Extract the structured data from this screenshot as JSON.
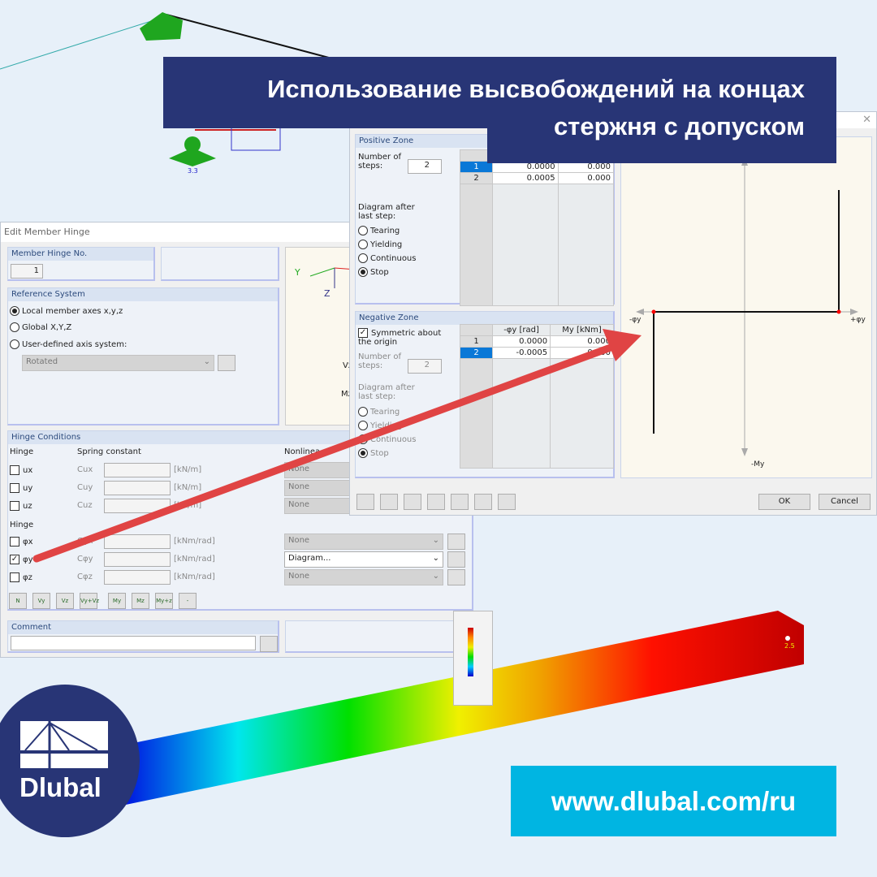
{
  "banner": {
    "line1": "Использование высвобождений на концах",
    "line2": "стержня с допуском",
    "color": "#283576"
  },
  "model": {
    "node_label": "3.3",
    "beam_value": "2.5"
  },
  "left_dialog": {
    "title": "Edit Member Hinge",
    "hinge_no": {
      "label": "Member Hinge No.",
      "value": "1"
    },
    "reference": {
      "label": "Reference System",
      "options": [
        "Local member axes x,y,z",
        "Global X,Y,Z",
        "User-defined axis system:"
      ],
      "selected": 0,
      "axis_value": "Rotated"
    },
    "preview_axes": {
      "y": "Y",
      "z": "Z",
      "vz": "Vz",
      "mz": "Mz"
    },
    "conditions": {
      "label": "Hinge Conditions",
      "hinge_label": "Hinge",
      "spring_label": "Spring constant",
      "nonlinear_label": "Nonlinea",
      "translations": [
        {
          "name": "ux",
          "const": "Cux",
          "unit": "[kN/m]",
          "checked": false,
          "nonlinear": "None"
        },
        {
          "name": "uy",
          "const": "Cuy",
          "unit": "[kN/m]",
          "checked": false,
          "nonlinear": "None"
        },
        {
          "name": "uz",
          "const": "Cuz",
          "unit": "[kN/m]",
          "checked": false,
          "nonlinear": "None"
        }
      ],
      "hinge_label2": "Hinge",
      "rotations": [
        {
          "name": "φx",
          "const": "Cφx",
          "unit": "[kNm/rad]",
          "checked": false,
          "nonlinear": "None"
        },
        {
          "name": "φy",
          "const": "Cφy",
          "unit": "[kNm/rad]",
          "checked": true,
          "nonlinear": "Diagram..."
        },
        {
          "name": "φz",
          "const": "Cφz",
          "unit": "[kNm/rad]",
          "checked": false,
          "nonlinear": "None"
        }
      ],
      "toolbar": [
        "N",
        "Vy",
        "Vz",
        "Vy+Vz",
        "My",
        "Mz",
        "My+z",
        "-"
      ]
    },
    "comment": {
      "label": "Comment",
      "value": ""
    }
  },
  "right_dialog": {
    "positive": {
      "label": "Positive Zone",
      "steps_label": "Number of steps:",
      "steps": "2",
      "after_label": "Diagram after last step:",
      "options": [
        "Tearing",
        "Yielding",
        "Continuous",
        "Stop"
      ],
      "selected": 3,
      "rows": [
        [
          "1",
          "0.0000",
          "0.000"
        ],
        [
          "2",
          "0.0005",
          "0.000"
        ]
      ]
    },
    "negative": {
      "label": "Negative Zone",
      "symmetric": "Symmetric about the origin",
      "steps_label": "Number of steps:",
      "steps": "2",
      "after_label": "Diagram after last step:",
      "options": [
        "Tearing",
        "Yielding",
        "Continuous",
        "Stop"
      ],
      "selected": 3,
      "headers": [
        "-φy [rad]",
        "My [kNm]"
      ],
      "rows": [
        [
          "1",
          "0.0000",
          "0.000"
        ],
        [
          "2",
          "-0.0005",
          "0.000"
        ]
      ]
    },
    "diagram": {
      "neg_x": "-φy",
      "pos_x": "+φy",
      "neg_y": "-My"
    },
    "ok": "OK",
    "cancel": "Cancel"
  },
  "logo": {
    "text": "Dlubal"
  },
  "url": {
    "text": "www.dlubal.com/ru",
    "color": "#00b5e2"
  }
}
